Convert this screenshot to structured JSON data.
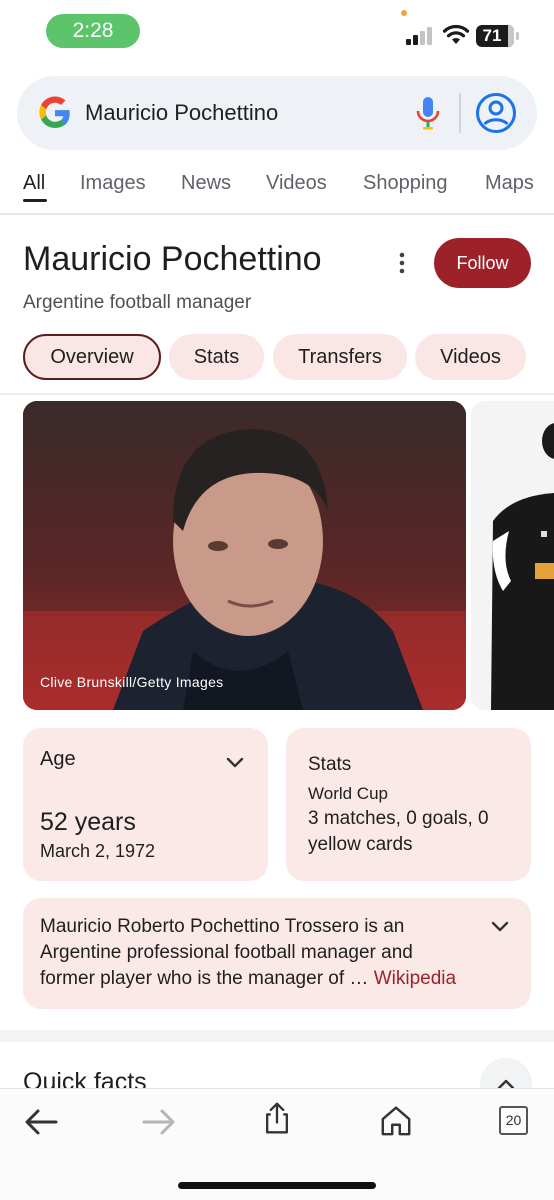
{
  "status_bar": {
    "time": "2:28",
    "battery": "71"
  },
  "search": {
    "query": "Mauricio Pochettino"
  },
  "tabs": [
    {
      "label": "All",
      "active": true
    },
    {
      "label": "Images",
      "active": false
    },
    {
      "label": "News",
      "active": false
    },
    {
      "label": "Videos",
      "active": false
    },
    {
      "label": "Shopping",
      "active": false
    },
    {
      "label": "Maps",
      "active": false
    }
  ],
  "entity": {
    "title": "Mauricio Pochettino",
    "subtitle": "Argentine football manager",
    "follow_label": "Follow"
  },
  "chips": [
    {
      "label": "Overview",
      "active": true
    },
    {
      "label": "Stats",
      "active": false
    },
    {
      "label": "Transfers",
      "active": false
    },
    {
      "label": "Videos",
      "active": false
    }
  ],
  "image": {
    "credit": "Clive Brunskill/Getty Images"
  },
  "age_card": {
    "label": "Age",
    "value": "52 years",
    "date": "March 2, 1972"
  },
  "stats_card": {
    "label": "Stats",
    "competition": "World Cup",
    "line1": "3 matches, 0 goals, 0",
    "line2": "yellow cards"
  },
  "description": {
    "line1": "Mauricio Roberto Pochettino Trossero is an",
    "line2": "Argentine professional football manager and",
    "line3": "former player who is the manager of … ",
    "source": "Wikipedia"
  },
  "quick_facts": {
    "title": "Quick facts"
  },
  "toolbar": {
    "tab_count": "20"
  },
  "colors": {
    "accent": "#9c2129",
    "chip_bg": "#fbe6e6",
    "card_bg": "#fbe9e8",
    "status_green": "#5cc56c"
  }
}
